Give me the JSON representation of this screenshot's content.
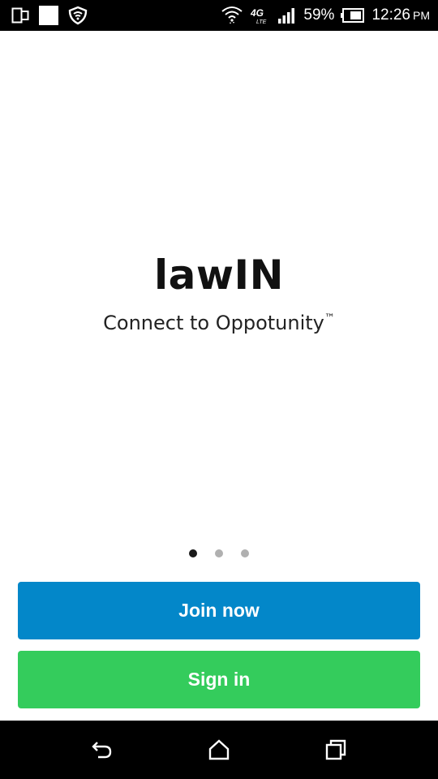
{
  "status_bar": {
    "battery_percent": "59%",
    "time": "12:26",
    "time_suffix": "PM",
    "network_label": "4G",
    "icons": [
      "screen-cast-icon",
      "notification-square-icon",
      "vpn-shield-icon",
      "wifi-icon",
      "lte-icon",
      "signal-icon",
      "battery-icon"
    ]
  },
  "hero": {
    "title": "lawIN",
    "tagline": "Connect to Oppotunity",
    "tagline_mark": "™"
  },
  "pager": {
    "pages": 3,
    "active_index": 0
  },
  "actions": {
    "join_label": "Join now",
    "join_color": "#0387c9",
    "sign_in_label": "Sign in",
    "sign_in_color": "#34cc5c"
  },
  "nav_bar": {
    "icons": [
      "back-icon",
      "home-icon",
      "recents-icon"
    ]
  }
}
